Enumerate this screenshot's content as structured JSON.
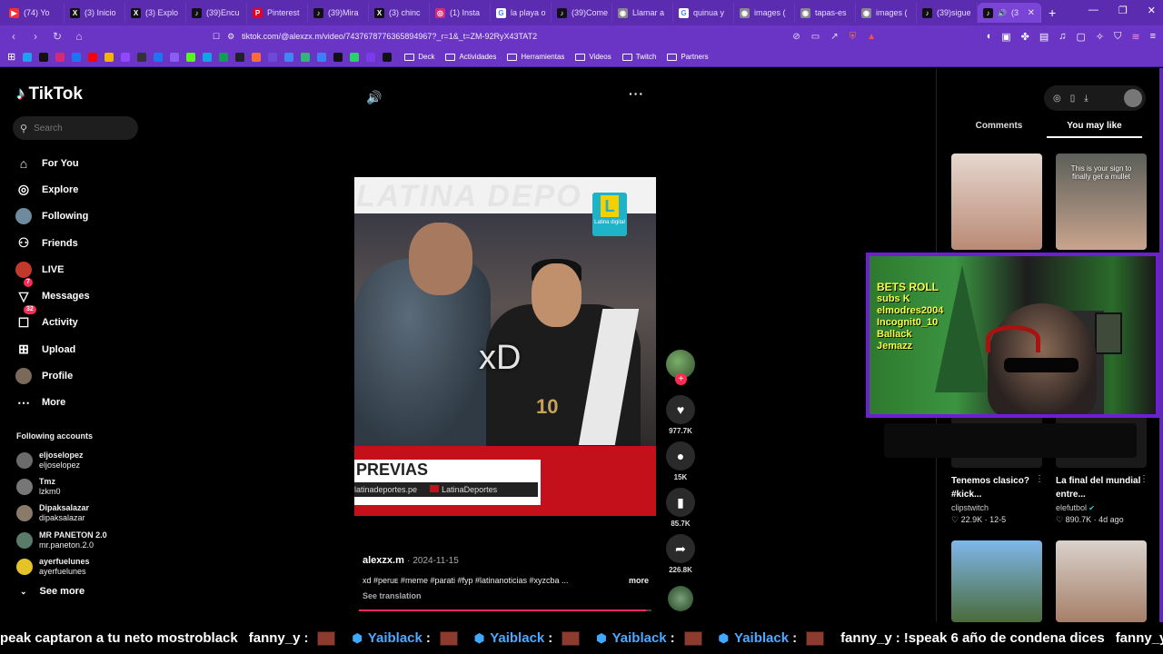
{
  "browser": {
    "tabs": [
      {
        "label": "(74) Yo",
        "icon": "youtube-icon",
        "color": "#ff2d2d",
        "glyph": "▶"
      },
      {
        "label": "(3) Inicio",
        "icon": "x-icon",
        "color": "#111111",
        "glyph": "X"
      },
      {
        "label": "(3) Explo",
        "icon": "x-icon",
        "color": "#111111",
        "glyph": "X"
      },
      {
        "label": "(39)Encu",
        "icon": "tiktok-icon",
        "color": "#111111",
        "glyph": "♪"
      },
      {
        "label": "Pinterest",
        "icon": "pinterest-icon",
        "color": "#e60023",
        "glyph": "P"
      },
      {
        "label": "(39)Mira",
        "icon": "tiktok-icon",
        "color": "#111111",
        "glyph": "♪"
      },
      {
        "label": "(3) chinc",
        "icon": "x-icon",
        "color": "#111111",
        "glyph": "X"
      },
      {
        "label": "(1) Insta",
        "icon": "instagram-icon",
        "color": "#d62976",
        "glyph": "◎"
      },
      {
        "label": "la playa o",
        "icon": "google-icon",
        "color": "#ffffff",
        "glyph": "G"
      },
      {
        "label": "(39)Come",
        "icon": "tiktok-icon",
        "color": "#111111",
        "glyph": "♪"
      },
      {
        "label": "Llamar a",
        "icon": "web-icon",
        "color": "#888888",
        "glyph": "◉"
      },
      {
        "label": "quinua y",
        "icon": "google-icon",
        "color": "#ffffff",
        "glyph": "G"
      },
      {
        "label": "images (",
        "icon": "web-icon",
        "color": "#888888",
        "glyph": "◉"
      },
      {
        "label": "tapas-es",
        "icon": "web-icon",
        "color": "#888888",
        "glyph": "◉"
      },
      {
        "label": "images (",
        "icon": "web-icon",
        "color": "#888888",
        "glyph": "◉"
      },
      {
        "label": "(39)sigue",
        "icon": "tiktok-icon",
        "color": "#111111",
        "glyph": "♪"
      }
    ],
    "active_tab": {
      "label": "(3",
      "icon": "tiktok-icon",
      "glyph": "♪"
    },
    "url": "tiktok.com/@alexzx.m/video/7437678776365894967?_r=1&_t=ZM-92RyX43TAT2",
    "bookmarks": {
      "folders": [
        "Deck",
        "Actividades",
        "Herramientas",
        "Videos",
        "Twitch",
        "Partners"
      ],
      "icon_colors": [
        "#1da1f2",
        "#111111",
        "#d62976",
        "#1877f2",
        "#ff0000",
        "#f4b400",
        "#9146ff",
        "#333333",
        "#1877f2",
        "#8b5cf6",
        "#53fc18",
        "#0ea5e9",
        "#0f9d58",
        "#222222",
        "#ff6b35",
        "#6c4bd8",
        "#4285f4",
        "#2eb67d",
        "#3b82f6",
        "#111111",
        "#25d366",
        "#7c3aed",
        "#111111"
      ]
    }
  },
  "sidebar": {
    "logo": "TikTok",
    "search_placeholder": "Search",
    "nav": [
      {
        "label": "For You",
        "icon": "home-icon",
        "glyph": "⌂"
      },
      {
        "label": "Explore",
        "icon": "compass-icon",
        "glyph": "◎"
      },
      {
        "label": "Following",
        "icon": "following-avatar",
        "glyph": ""
      },
      {
        "label": "Friends",
        "icon": "friends-icon",
        "glyph": "⚇"
      },
      {
        "label": "LIVE",
        "icon": "live-avatar",
        "glyph": ""
      },
      {
        "label": "Messages",
        "icon": "messages-icon",
        "glyph": "▽",
        "badge": "7"
      },
      {
        "label": "Activity",
        "icon": "activity-icon",
        "glyph": "☐",
        "badge": "32"
      },
      {
        "label": "Upload",
        "icon": "upload-icon",
        "glyph": "⊞"
      },
      {
        "label": "Profile",
        "icon": "profile-avatar",
        "glyph": ""
      },
      {
        "label": "More",
        "icon": "more-icon",
        "glyph": "⋯"
      }
    ],
    "following_heading": "Following accounts",
    "following": [
      {
        "display": "eljoselopez",
        "handle": "eljoselopez",
        "color": "#6b6b6b"
      },
      {
        "display": "Tmz",
        "handle": "lzkm0",
        "color": "#777777"
      },
      {
        "display": "Dipaksalazar",
        "handle": "dipaksalazar",
        "color": "#8a7a6a"
      },
      {
        "display": "MR PANETON 2.0",
        "handle": "mr.paneton.2.0",
        "color": "#5a7a6a"
      },
      {
        "display": "ayerfuelunes",
        "handle": "ayerfuelunes",
        "color": "#e6c229"
      }
    ],
    "see_more": "See more"
  },
  "video": {
    "overlay_text": "xD",
    "top_banner": "LATINA DEPO",
    "channel_logo": "Latina digital",
    "jersey_number": "10",
    "lower_third_title": "PREVIAS",
    "lower_third_site": "latinadeportes.pe",
    "lower_third_handle": "LatinaDeportes",
    "progress": 0.98,
    "author": "alexzx.m",
    "date": "2024-11-15",
    "description": "xd #peruᴇ #meme #parati #fyp #latinanoticias #xyzcba ...",
    "more_label": "more",
    "see_translation": "See translation",
    "actions": [
      {
        "name": "like",
        "icon": "heart-icon",
        "glyph": "♥",
        "count": "977.7K"
      },
      {
        "name": "comment",
        "icon": "comment-icon",
        "glyph": "●",
        "count": "15K"
      },
      {
        "name": "save",
        "icon": "bookmark-icon",
        "glyph": "▮",
        "count": "85.7K"
      },
      {
        "name": "share",
        "icon": "share-icon",
        "glyph": "➦",
        "count": "226.8K"
      }
    ]
  },
  "right_panel": {
    "tabs": [
      "Comments",
      "You may like"
    ],
    "active_tab": "You may like",
    "thumb_caption": "This is your sign to finally get a mullet",
    "cards": [
      {
        "title": "Tenemos clasico? #kick...",
        "author": "clipstwitch",
        "likes": "22.9K",
        "date": "12-5",
        "verified": false
      },
      {
        "title": "La final del mundial entre...",
        "author": "elefutbol",
        "likes": "890.7K",
        "date": "4d ago",
        "verified": true
      }
    ]
  },
  "webcam": {
    "lines": [
      "BETS ROLL",
      "subs K",
      "elmodres2004",
      "Incognit0_10",
      "Ballack",
      "Jemazz"
    ]
  },
  "chat_ticker": [
    {
      "user": "",
      "text": "peak captaron a tu neto mostroblack",
      "style": "w"
    },
    {
      "user": "fanny_y",
      "text": "",
      "style": "w",
      "emote": true
    },
    {
      "user": "Yaiblack",
      "text": "",
      "style": "b",
      "emote": true,
      "shield": true
    },
    {
      "user": "Yaiblack",
      "text": "",
      "style": "b",
      "emote": true,
      "shield": true
    },
    {
      "user": "Yaiblack",
      "text": "",
      "style": "b",
      "emote": true,
      "shield": true
    },
    {
      "user": "Yaiblack",
      "text": "",
      "style": "b",
      "emote": true,
      "shield": true
    },
    {
      "user": "fanny_y",
      "text": "!speak 6 año de condena dices",
      "style": "w"
    },
    {
      "user": "fanny_y",
      "text": "",
      "style": "w",
      "emote": true
    }
  ]
}
